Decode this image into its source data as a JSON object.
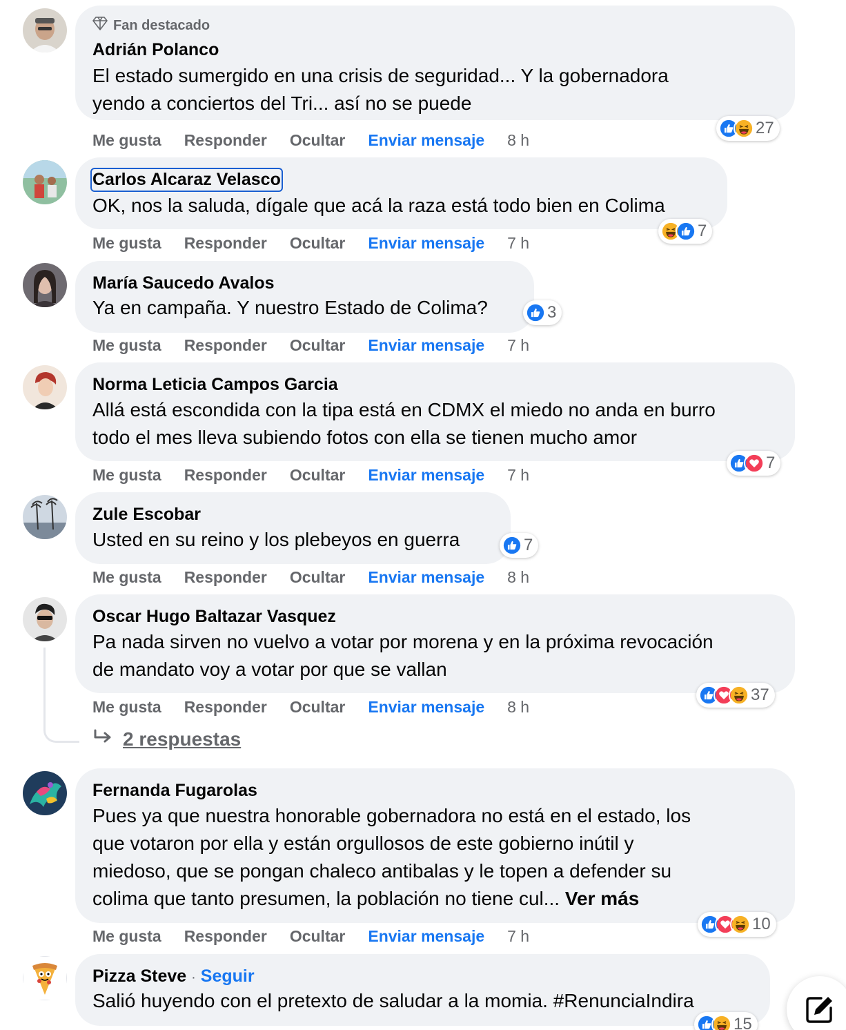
{
  "comments": [
    {
      "badge": "Fan destacado",
      "author": "Adrián Polanco",
      "lines": [
        "El estado sumergido en una crisis de seguridad... Y la gobernadora",
        "yendo a conciertos del Tri... así no se puede"
      ],
      "reactions": [
        "like",
        "haha"
      ],
      "reaction_count": "27",
      "time": "8 h"
    },
    {
      "author": "Carlos Alcaraz Velasco",
      "lines": [
        "OK, nos la saluda, dígale que acá la raza está todo bien en Colima"
      ],
      "reactions": [
        "haha",
        "like"
      ],
      "reaction_count": "7",
      "time": "7 h"
    },
    {
      "author": "María Saucedo Avalos",
      "lines": [
        "Ya en campaña. Y nuestro Estado de Colima?"
      ],
      "reactions": [
        "like"
      ],
      "reaction_count": "3",
      "time": "7 h"
    },
    {
      "author": "Norma Leticia Campos Garcia",
      "lines": [
        "Allá está escondida con la tipa está en CDMX el miedo no anda en burro",
        "todo el mes lleva subiendo fotos con ella se tienen mucho amor"
      ],
      "reactions": [
        "like",
        "love"
      ],
      "reaction_count": "7",
      "time": "7 h"
    },
    {
      "author": "Zule Escobar",
      "lines": [
        "Usted en su reino y los plebeyos en guerra"
      ],
      "reactions": [
        "like"
      ],
      "reaction_count": "7",
      "time": "8 h"
    },
    {
      "author": "Oscar Hugo Baltazar Vasquez",
      "lines": [
        "Pa nada sirven no vuelvo a votar por morena y en la próxima revocación",
        "de mandato voy a votar por que se vallan"
      ],
      "reactions": [
        "like",
        "love",
        "haha"
      ],
      "reaction_count": "37",
      "time": "8 h"
    },
    {
      "author": "Fernanda Fugarolas",
      "lines": [
        "Pues ya que nuestra honorable gobernadora no está en el estado, los",
        "que votaron por ella y están orgullosos de este gobierno inútil y",
        "miedoso, que se pongan chaleco antibalas y le topen a defender su",
        "colima que tanto presumen, la población no tiene cul... "
      ],
      "see_more": "Ver más",
      "reactions": [
        "like",
        "love",
        "haha"
      ],
      "reaction_count": "10",
      "time": "7 h"
    },
    {
      "author": "Pizza Steve",
      "follow_sep": "·",
      "follow": "Seguir",
      "lines": [
        "Salió huyendo con el pretexto de saludar a la momia. #RenunciaIndira"
      ],
      "reactions": [
        "like",
        "haha"
      ],
      "reaction_count": "15"
    }
  ],
  "actions": {
    "like": "Me gusta",
    "reply": "Responder",
    "hide": "Ocultar",
    "message": "Enviar mensaje"
  },
  "replies_label": "2 respuestas",
  "colors": {
    "like": "#1877f2",
    "love": "#f33e58",
    "haha": "#f7b125",
    "bubble": "#f0f2f5",
    "meta": "#65676b"
  },
  "icons": {
    "badge": "diamond-icon",
    "replies": "reply-arrow-icon",
    "compose": "compose-icon"
  }
}
